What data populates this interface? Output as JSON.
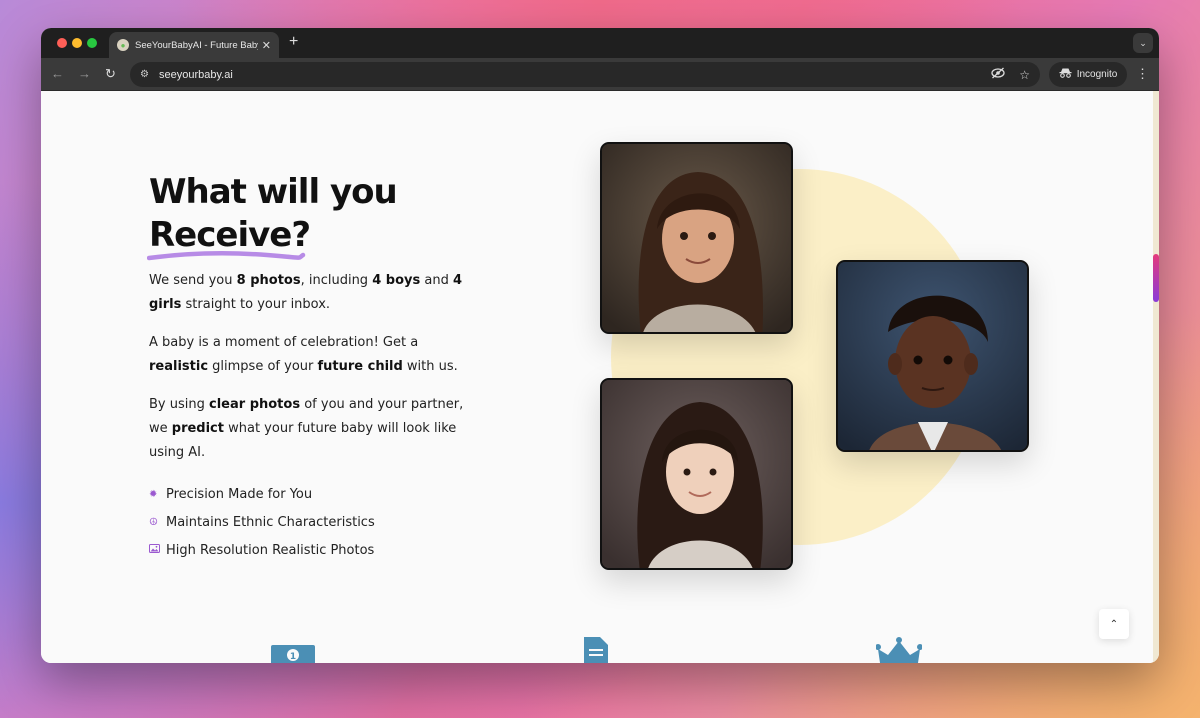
{
  "browser": {
    "tab_title": "SeeYourBabyAI - Future Baby",
    "url": "seeyourbaby.ai",
    "incognito_label": "Incognito"
  },
  "hero": {
    "heading_line1": "What will you",
    "heading_line2": "Receive?",
    "p1": {
      "a": "We send you ",
      "b": "8 photos",
      "c": ", including ",
      "d": "4 boys",
      "e": " and ",
      "f": "4 girls",
      "g": " straight to your inbox."
    },
    "p2": {
      "a": "A baby is a moment of celebration! Get a ",
      "b": "realistic",
      "c": " glimpse of your ",
      "d": "future child",
      "e": " with us."
    },
    "p3": {
      "a": "By using ",
      "b": "clear photos",
      "c": " of you and your partner, we ",
      "d": "predict",
      "e": " what your future baby will look like using AI."
    },
    "features": [
      {
        "label": "Precision Made for You",
        "icon": "gear-icon"
      },
      {
        "label": "Maintains Ethnic Characteristics",
        "icon": "peace-icon"
      },
      {
        "label": "High Resolution Realistic Photos",
        "icon": "image-icon"
      }
    ]
  },
  "colors": {
    "accent": "#9b59d0",
    "circle": "#fbefc7",
    "bottom_icons": "#4b8fb5"
  }
}
